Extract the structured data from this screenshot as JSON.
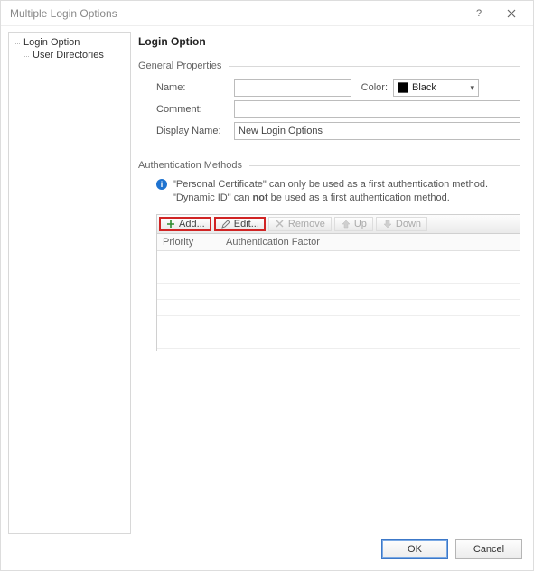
{
  "titlebar": {
    "title": "Multiple Login Options"
  },
  "tree": {
    "items": [
      {
        "label": "Login Option"
      },
      {
        "label": "User Directories"
      }
    ]
  },
  "page": {
    "title": "Login Option"
  },
  "sections": {
    "general": {
      "header": "General Properties"
    },
    "auth": {
      "header": "Authentication Methods"
    }
  },
  "form": {
    "name": {
      "label": "Name:",
      "value": ""
    },
    "color": {
      "label": "Color:",
      "value": "Black"
    },
    "comment": {
      "label": "Comment:",
      "value": ""
    },
    "display_name": {
      "label": "Display Name:",
      "value": "New Login Options"
    }
  },
  "info": {
    "line1_prefix": "\"Personal Certificate\" can only be used as a first authentication method.",
    "line2_pre": "\"Dynamic ID\" can ",
    "line2_bold": "not",
    "line2_post": " be used as a first authentication method."
  },
  "toolbar": {
    "add": "Add...",
    "edit": "Edit...",
    "remove": "Remove",
    "up": "Up",
    "down": "Down"
  },
  "grid": {
    "columns": {
      "priority": "Priority",
      "factor": "Authentication Factor"
    }
  },
  "footer": {
    "ok": "OK",
    "cancel": "Cancel"
  }
}
